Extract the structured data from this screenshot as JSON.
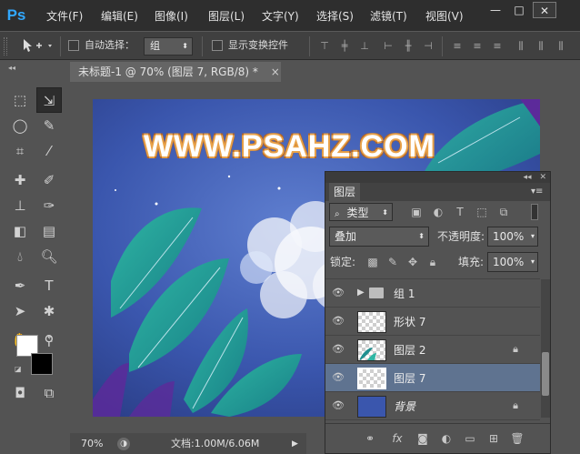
{
  "app": {
    "logo": "Ps"
  },
  "menu": [
    "文件(F)",
    "编辑(E)",
    "图像(I)",
    "图层(L)",
    "文字(Y)",
    "选择(S)",
    "滤镜(T)",
    "视图(V)"
  ],
  "window_controls": {
    "minimize": "—",
    "restore": "□",
    "close": "✕"
  },
  "options_bar": {
    "auto_select_label": "自动选择：",
    "auto_select_value": "组",
    "show_transform_label": "显示变换控件"
  },
  "document": {
    "tab_title": "未标题-1 @ 70% (图层 7, RGB/8) *",
    "tab_close": "×",
    "canvas_text": "WWW.PSAHZ.COM",
    "zoom": "70%",
    "doc_info": "文档:1.00M/6.06M"
  },
  "layers_panel": {
    "tab": "图层",
    "filter_label": "类型",
    "blend_mode": "叠加",
    "opacity_label": "不透明度:",
    "opacity_value": "100%",
    "lock_label": "锁定:",
    "fill_label": "填充:",
    "fill_value": "100%",
    "layers": [
      {
        "name": "组 1",
        "type": "group"
      },
      {
        "name": "形状 7",
        "type": "shape"
      },
      {
        "name": "图层 2",
        "type": "pixel"
      },
      {
        "name": "图层 7",
        "type": "pixel"
      },
      {
        "name": "背景",
        "type": "background"
      }
    ]
  },
  "icons": {
    "move": "move-tool-icon",
    "eye": "eye-icon",
    "lock": "lock-icon",
    "folder": "folder-icon"
  },
  "colors": {
    "foreground": "#ffffff",
    "background": "#000000",
    "canvas_bg": "#3a56ad",
    "text_accent": "#e8a24a",
    "selected_row": "#5f7390"
  }
}
